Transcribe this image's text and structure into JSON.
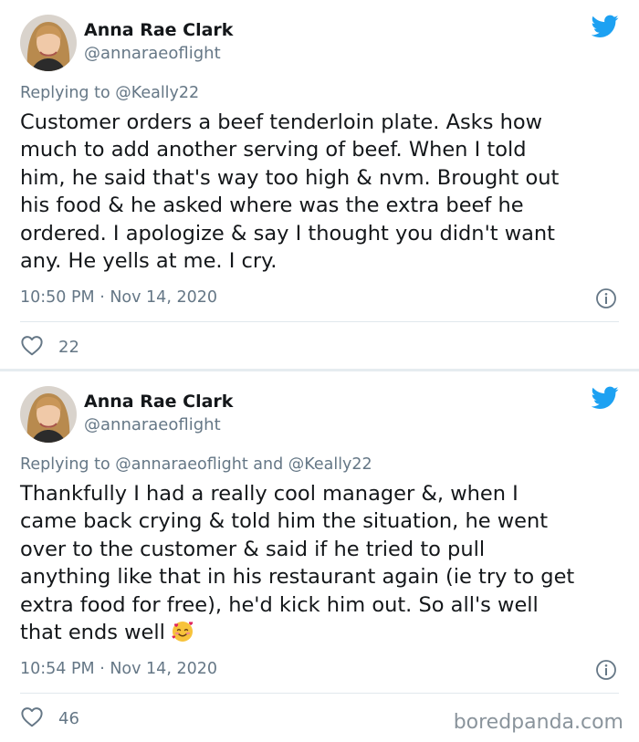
{
  "tweets": [
    {
      "name": "Anna Rae Clark",
      "handle": "@annaraeoflight",
      "reply_to": "Replying to @Keally22",
      "text": "Customer orders a beef tenderloin plate. Asks how\nmuch to add another serving of beef. When I told\nhim, he said that's way too high & nvm. Brought out\nhis food & he asked where was the extra beef he\nordered. I apologize & say I thought you didn't want\nany. He yells at me. I cry.",
      "timestamp": "10:50 PM · Nov 14, 2020",
      "likes": "22"
    },
    {
      "name": "Anna Rae Clark",
      "handle": "@annaraeoflight",
      "reply_to": "Replying to @annaraeoflight and @Keally22",
      "text": "Thankfully I had a really cool manager &, when I\ncame back crying & told him the situation, he went\nover to the customer & said if he tried to pull\nanything like that in his restaurant again (ie try to get\nextra food for free), he'd kick him out. So all's well\nthat ends well",
      "emoji": "smiling-face-with-hearts",
      "timestamp": "10:54 PM · Nov 14, 2020",
      "likes": "46"
    }
  ],
  "watermark": "boredpanda.com",
  "colors": {
    "twitter_blue": "#1da1f2",
    "secondary_text": "#657786",
    "divider": "#e1e8ed"
  },
  "icons": [
    "twitter-bird-icon",
    "info-icon",
    "heart-icon"
  ]
}
